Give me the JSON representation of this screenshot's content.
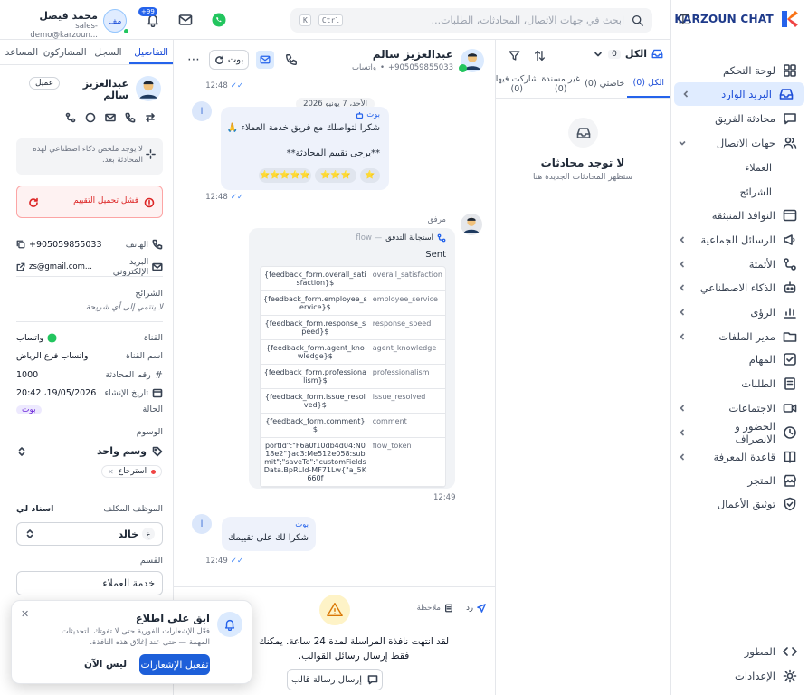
{
  "brand": {
    "name": "KARZOUN CHAT"
  },
  "sidebar": {
    "items": [
      {
        "label": "لوحة التحكم",
        "icon": "grid-icon"
      },
      {
        "label": "البريد الوارد",
        "icon": "inbox-icon"
      },
      {
        "label": "محادثة الفريق",
        "icon": "chat-icon"
      },
      {
        "label": "جهات الاتصال",
        "icon": "users-icon"
      },
      {
        "label": "النوافذ المنبثقة",
        "icon": "window-icon"
      },
      {
        "label": "الرسائل الجماعية",
        "icon": "megaphone-icon"
      },
      {
        "label": "الأتمتة",
        "icon": "flow-icon"
      },
      {
        "label": "الذكاء الاصطناعي",
        "icon": "robot-icon"
      },
      {
        "label": "الرؤى",
        "icon": "chart-icon"
      },
      {
        "label": "مدير الملفات",
        "icon": "folder-icon"
      },
      {
        "label": "المهام",
        "icon": "checkbox-icon"
      },
      {
        "label": "الطلبات",
        "icon": "orders-icon"
      },
      {
        "label": "الاجتماعات",
        "icon": "video-icon"
      },
      {
        "label": "الحضور و الانصراف",
        "icon": "clock-icon"
      },
      {
        "label": "قاعدة المعرفة",
        "icon": "book-icon"
      },
      {
        "label": "المتجر",
        "icon": "store-icon"
      },
      {
        "label": "توثيق الأعمال",
        "icon": "shield-icon"
      }
    ],
    "contacts_sub": [
      "العملاء",
      "الشرائح"
    ],
    "bottom": [
      {
        "label": "المطور",
        "icon": "code-icon"
      },
      {
        "label": "الإعدادات",
        "icon": "gear-icon"
      }
    ]
  },
  "topbar": {
    "search_placeholder": "ابحث في جهات الاتصال، المحادثات، الطلبات...",
    "shortcut_ctrl": "Ctrl",
    "shortcut_k": "K",
    "notifications_badge": "+99",
    "user": {
      "name": "محمد فيصل",
      "email": "sales-demo@karzoun...",
      "initials": "مف"
    }
  },
  "list": {
    "filter_label": "الكل",
    "filter_count": "0",
    "tabs": [
      {
        "label": "الكل (0)"
      },
      {
        "label": "خاصتي (0)"
      },
      {
        "label": "غير مسندة (0)"
      },
      {
        "label": "شاركت فيها (0)"
      }
    ],
    "empty_title": "لا توجد محادثات",
    "empty_sub": "ستظهر المحادثات الجديدة هنا"
  },
  "chat": {
    "contact_name": "عبدالعزيز سالم",
    "contact_phone": "905059855033+",
    "contact_channel": "واتساب",
    "bot_button": "بوت",
    "time_1": "12:48",
    "date_chip": "الأحد، 7 يونيو 2026",
    "bot_label": "بوت",
    "msg1_line1": "شكرا لتواصلك مع فريق خدمة العملاء 🙏",
    "msg1_line2": "**يرجى تقييم المحادثة**",
    "ratings": [
      "⭐",
      "⭐⭐⭐",
      "⭐⭐⭐⭐⭐"
    ],
    "time_2": "12:48",
    "attachment_label": "مرفق",
    "flow_title": "استجابة التدفق",
    "flow_tag": "flow —",
    "flow_status": "Sent",
    "flow_rows": [
      {
        "k": "overall_satisfaction",
        "v": "{feedback_form.overall_satisfaction}$"
      },
      {
        "k": "employee_service",
        "v": "{feedback_form.employee_service}$"
      },
      {
        "k": "response_speed",
        "v": "{feedback_form.response_speed}$"
      },
      {
        "k": "agent_knowledge",
        "v": "{feedback_form.agent_knowledge}$"
      },
      {
        "k": "professionalism",
        "v": "{feedback_form.professionalism}$"
      },
      {
        "k": "issue_resolved",
        "v": "{feedback_form.issue_resolved}$"
      },
      {
        "k": "comment",
        "v": "{feedback_form.comment}$"
      },
      {
        "k": "flow_token",
        "v": "portId\":\"F6a0f10db4d04:N018e2\"}ac3:Me512e058:submit\";\"saveTo\":\"customFieldsData.BpRLId-MF71Lw{\"a_5K660f"
      }
    ],
    "time_3": "12:49",
    "msg3_text": "شكرا لك على تقييمك",
    "time_4": "12:49",
    "avatar_initial": "ا",
    "composer_reply": "رد",
    "composer_note": "ملاحظة",
    "window_closed_text": "لقد انتهت نافذة المراسلة لمدة 24 ساعة. يمكنك فقط إرسال رسائل القوالب.",
    "send_template": "إرسال رسالة قالب"
  },
  "details": {
    "tabs": [
      "التفاصيل",
      "السجل",
      "المشاركون",
      "المساعد"
    ],
    "name": "عبدالعزيز سالم",
    "role_badge": "عميل",
    "ai_summary": "لا يوجد ملخص ذكاء اصطناعي لهذه المحادثة بعد.",
    "rating_error": "فشل تحميل التقييم",
    "phone_label": "الهاتف",
    "phone_value": "905059855033+",
    "email_label": "البريد الإلكتروني",
    "email_value": "zs@gmail.com...",
    "segments_label": "الشرائح",
    "segments_value": "لا ينتمي إلى أي شريحة",
    "channel_label": "القناة",
    "channel_value": "واتساب",
    "channel_name_label": "اسم القناة",
    "channel_name_value": "واتساب فرع الرياض",
    "conv_no_label": "رقم المحادثة",
    "conv_no_value": "1000",
    "created_label": "تاريخ الإنشاء",
    "created_value": "19/05/2026، 20:42",
    "status_label": "الحالة",
    "status_value": "بوت",
    "tags_label": "الوسوم",
    "tags_add": "وسم واحد",
    "tag_1": "استرجاع",
    "assignee_label": "الموظف المكلف",
    "assign_me": "اسناد لي",
    "assignee_value": "خالد",
    "assignee_initial": "خ",
    "dept_label": "القسم",
    "dept_value": "خدمة العملاء"
  },
  "toast": {
    "title": "ابق على اطلاع",
    "body": "فعّل الإشعارات الفورية حتى لا تفوتك التحديثات المهمة — حتى عند إغلاق هذه النافذة.",
    "enable": "تفعيل الإشعارات",
    "later": "ليس الآن"
  }
}
